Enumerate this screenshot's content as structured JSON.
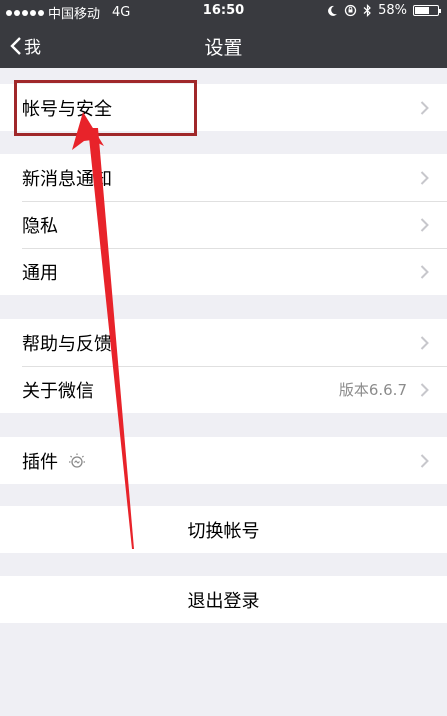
{
  "status_bar": {
    "carrier": "中国移动",
    "network": "4G",
    "time": "16:50",
    "battery": "58%",
    "battery_level": 0.58,
    "icons": [
      "signal-dots-icon",
      "moon-icon",
      "orientation-lock-icon",
      "bluetooth-icon",
      "battery-icon"
    ]
  },
  "nav": {
    "back_label": "我",
    "title": "设置"
  },
  "groups": [
    {
      "items": [
        {
          "label": "帐号与安全"
        }
      ]
    },
    {
      "items": [
        {
          "label": "新消息通知"
        },
        {
          "label": "隐私"
        },
        {
          "label": "通用"
        }
      ]
    },
    {
      "items": [
        {
          "label": "帮助与反馈"
        },
        {
          "label": "关于微信",
          "value": "版本6.6.7"
        }
      ]
    },
    {
      "items": [
        {
          "label": "插件",
          "icon": "plugin-bulb-icon"
        }
      ]
    }
  ],
  "actions": {
    "switch_account": "切换帐号",
    "logout": "退出登录"
  },
  "colors": {
    "nav_background": "#393a3f",
    "page_background": "#efeff4",
    "annotation": "#a0282a",
    "arrow": "#e8232a"
  }
}
